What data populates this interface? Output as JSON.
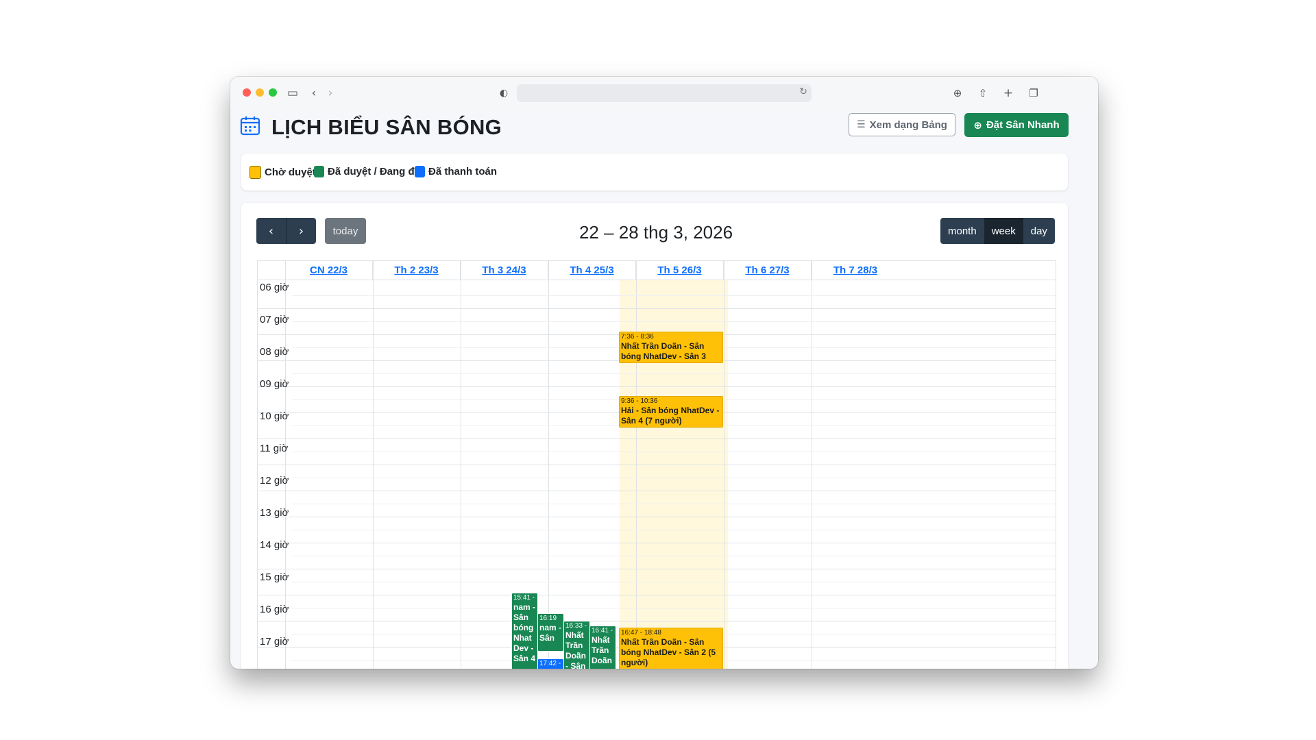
{
  "page": {
    "title": "LỊCH BIỂU SÂN BÓNG",
    "btn_table": "Xem dạng Bảng",
    "btn_book": "Đặt Sân Nhanh"
  },
  "legend": [
    {
      "label": "Chờ duyệt",
      "color": "#ffc107"
    },
    {
      "label": "Đã duyệt / Đang đá",
      "color": "#198754"
    },
    {
      "label": "Đã thanh toán",
      "color": "#0d6efd"
    }
  ],
  "calendar": {
    "title": "22 – 28 thg 3, 2026",
    "today_label": "today",
    "views": [
      "month",
      "week",
      "day"
    ],
    "active_view": "week",
    "days": [
      "CN 22/3",
      "Th 2 23/3",
      "Th 3 24/3",
      "Th 4 25/3",
      "Th 5 26/3",
      "Th 6 27/3",
      "Th 7 28/3"
    ],
    "hours": [
      "06 giờ",
      "07 giờ",
      "08 giờ",
      "09 giờ",
      "10 giờ",
      "11 giờ",
      "12 giờ",
      "13 giờ",
      "14 giờ",
      "15 giờ",
      "16 giờ",
      "17 giờ"
    ]
  },
  "events": [
    {
      "time": "7:36 - 8:36",
      "title": "Nhất Trần Doãn - Sân bóng NhatDev - Sân 3",
      "day": "Th 4 25/3",
      "status": "Chờ duyệt"
    },
    {
      "time": "9:36 - 10:36",
      "title": "Hải - Sân bóng NhatDev - Sân 4 (7 người)",
      "day": "Th 4 25/3",
      "status": "Chờ duyệt"
    },
    {
      "time": "16:47 - 18:48",
      "title": "Nhất Trần Doãn - Sân bóng NhatDev - Sân 2 (5 người)",
      "day": "Th 4 25/3",
      "status": "Chờ duyệt"
    },
    {
      "time": "15:41 -",
      "title": "nam - Sân bóng Nhat Dev - Sân 4",
      "day": "Th 3 24/3",
      "status": "Đã duyệt / Đang đá"
    },
    {
      "time": "16:19",
      "title": "nam - Sân",
      "day": "Th 3 24/3",
      "status": "Đã duyệt / Đang đá"
    },
    {
      "time": "17:42 -",
      "title": "",
      "day": "Th 3 24/3",
      "status": "Đã thanh toán"
    },
    {
      "time": "16:33 -",
      "title": "Nhất Trần Doãn - Sân",
      "day": "Th 3 24/3",
      "status": "Đã duyệt / Đang đá"
    },
    {
      "time": "16:41 -",
      "title": "Nhất Trần Doãn",
      "day": "Th 3 24/3",
      "status": "Đã duyệt / Đang đá"
    }
  ]
}
